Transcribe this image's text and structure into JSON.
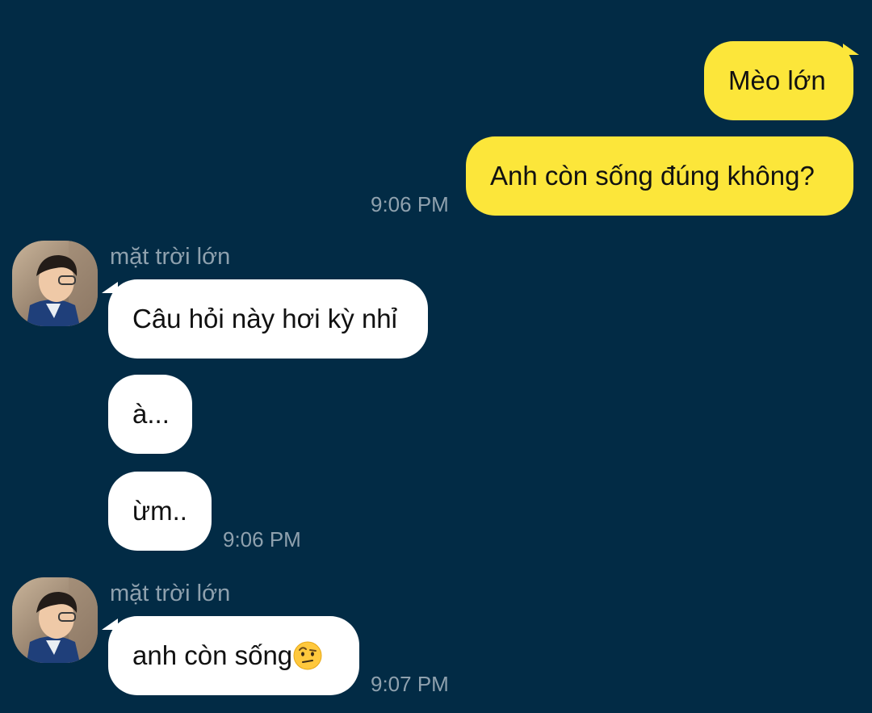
{
  "messages_out": [
    {
      "text": "Mèo lớn"
    },
    {
      "text": "Anh còn sống đúng không?",
      "time": "9:06 PM"
    }
  ],
  "group1": {
    "sender": "mặt trời lớn",
    "messages": [
      {
        "text": "Câu hỏi này hơi kỳ nhỉ"
      },
      {
        "text": "à..."
      },
      {
        "text": "ừm..",
        "time": "9:06 PM"
      }
    ]
  },
  "group2": {
    "sender": "mặt trời lớn",
    "messages": [
      {
        "text": "anh còn sống",
        "emoji": "raised-eyebrow-emoji",
        "time": "9:07 PM"
      }
    ]
  },
  "colors": {
    "background": "#022B45",
    "outgoing_bubble": "#FCE63A",
    "incoming_bubble": "#FFFFFF",
    "meta_text": "#8FA1AE"
  }
}
